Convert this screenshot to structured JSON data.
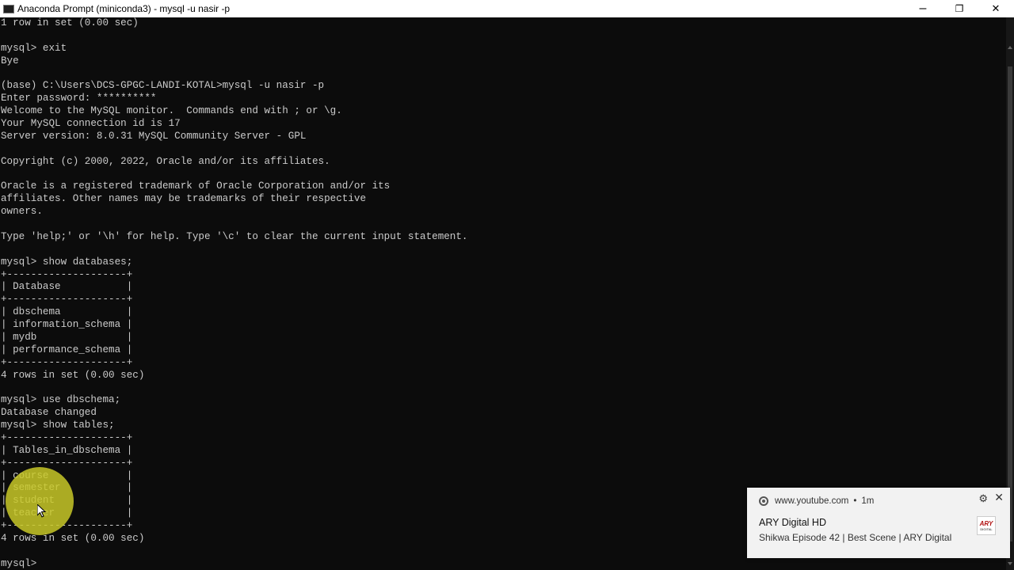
{
  "window": {
    "title": "Anaconda Prompt (miniconda3) - mysql  -u nasir -p",
    "controls": {
      "minimize": "–",
      "restore": "❐",
      "close": "✕"
    }
  },
  "terminal": {
    "lines": [
      "1 row in set (0.00 sec)",
      "",
      "mysql> exit",
      "Bye",
      "",
      "(base) C:\\Users\\DCS-GPGC-LANDI-KOTAL>mysql -u nasir -p",
      "Enter password: **********",
      "Welcome to the MySQL monitor.  Commands end with ; or \\g.",
      "Your MySQL connection id is 17",
      "Server version: 8.0.31 MySQL Community Server - GPL",
      "",
      "Copyright (c) 2000, 2022, Oracle and/or its affiliates.",
      "",
      "Oracle is a registered trademark of Oracle Corporation and/or its",
      "affiliates. Other names may be trademarks of their respective",
      "owners.",
      "",
      "Type 'help;' or '\\h' for help. Type '\\c' to clear the current input statement.",
      "",
      "mysql> show databases;",
      "+--------------------+",
      "| Database           |",
      "+--------------------+",
      "| dbschema           |",
      "| information_schema |",
      "| mydb               |",
      "| performance_schema |",
      "+--------------------+",
      "4 rows in set (0.00 sec)",
      "",
      "mysql> use dbschema;",
      "Database changed",
      "mysql> show tables;",
      "+--------------------+",
      "| Tables_in_dbschema |",
      "+--------------------+",
      "| course             |",
      "| semester           |",
      "| student            |",
      "| teacher            |",
      "+--------------------+",
      "4 rows in set (0.00 sec)",
      "",
      "mysql> "
    ]
  },
  "notification": {
    "source": "www.youtube.com",
    "separator": "•",
    "time": "1m",
    "title": "ARY Digital HD",
    "body": "Shikwa Episode 42 | Best Scene | ARY Digital",
    "icons": {
      "settings": "⚙",
      "close": "✕"
    },
    "logo_text": "ARY",
    "logo_subtext": "DIGITAL"
  },
  "colors": {
    "terminal_bg": "#0c0c0c",
    "terminal_fg": "#cccccc",
    "cursor_highlight": "#c8c828",
    "toast_bg": "#f2f2f2"
  }
}
